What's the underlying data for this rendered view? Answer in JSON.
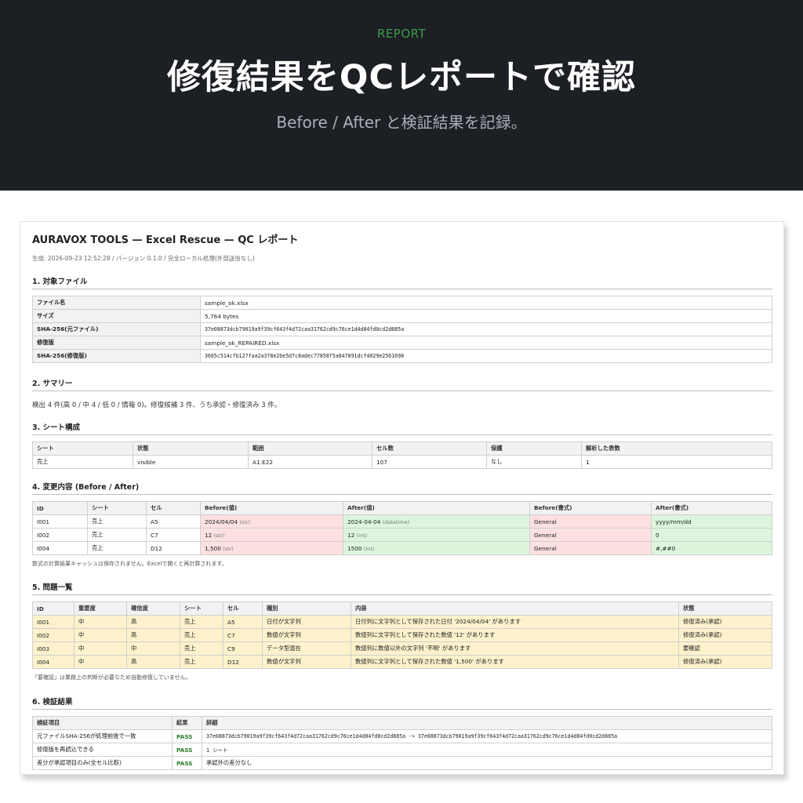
{
  "hero": {
    "tag": "REPORT",
    "title": "修復結果をQCレポートで確認",
    "subtitle": "Before / After と検証結果を記録。"
  },
  "report": {
    "title": "AURAVOX TOOLS — Excel Rescue — QC レポート",
    "meta": "生成: 2026-09-23 12:52:28 / バージョン 0.1.0 / 完全ローカル処理(外部送信なし)",
    "s1": {
      "heading": "1. 対象ファイル",
      "rows": [
        {
          "k": "ファイル名",
          "v": "sample_ok.xlsx"
        },
        {
          "k": "サイズ",
          "v": "5,764 bytes"
        },
        {
          "k": "SHA-256(元ファイル)",
          "v": "37e08873dcb79019a9f39cf643f4d72caa31762cd9c76ce1d4d84fd0cd2d885a"
        },
        {
          "k": "修復版",
          "v": "sample_ok_REPAIRED.xlsx"
        },
        {
          "k": "SHA-256(修復版)",
          "v": "3665c514cfb127faa2a378e2be5d7c8adec77858f5a847891dcf4029e2561698"
        }
      ]
    },
    "s2": {
      "heading": "2. サマリー",
      "text": "検出 4 件(高 0 / 中 4 / 低 0 / 情報 0)。修復候補 3 件、うち承認・修復済み 3 件。"
    },
    "s3": {
      "heading": "3. シート構成",
      "headers": [
        "シート",
        "状態",
        "範囲",
        "セル数",
        "保護",
        "解析した表数"
      ],
      "rows": [
        [
          "売上",
          "visible",
          "A1:E22",
          "107",
          "なし",
          "1"
        ]
      ]
    },
    "s4": {
      "heading": "4. 変更内容 (Before / After)",
      "headers": [
        "ID",
        "シート",
        "セル",
        "Before(値)",
        "After(値)",
        "Before(書式)",
        "After(書式)"
      ],
      "rows": [
        {
          "id": "I001",
          "sheet": "売上",
          "cell": "A5",
          "before": "2024/04/04",
          "before_t": "(str)",
          "after": "2024-04-04",
          "after_t": "(datetime)",
          "bfmt": "General",
          "afmt": "yyyy/mm/dd"
        },
        {
          "id": "I002",
          "sheet": "売上",
          "cell": "C7",
          "before": "12",
          "before_t": "(str)",
          "after": "12",
          "after_t": "(int)",
          "bfmt": "General",
          "afmt": "0"
        },
        {
          "id": "I004",
          "sheet": "売上",
          "cell": "D12",
          "before": "1,500",
          "before_t": "(str)",
          "after": "1500",
          "after_t": "(int)",
          "bfmt": "General",
          "afmt": "#,##0"
        }
      ],
      "note": "数式の計算結果キャッシュは保存されません。Excelで開くと再計算されます。"
    },
    "s5": {
      "heading": "5. 問題一覧",
      "headers": [
        "ID",
        "重要度",
        "確信度",
        "シート",
        "セル",
        "種別",
        "内容",
        "状態"
      ],
      "rows": [
        [
          "I001",
          "中",
          "高",
          "売上",
          "A5",
          "日付が文字列",
          "日付列に文字列として保存された日付 '2024/04/04' があります",
          "修復済み(承認)"
        ],
        [
          "I002",
          "中",
          "高",
          "売上",
          "C7",
          "数値が文字列",
          "数値列に文字列として保存された数値 '12' があります",
          "修復済み(承認)"
        ],
        [
          "I003",
          "中",
          "中",
          "売上",
          "C9",
          "データ型混在",
          "数値列に数値以外の文字列 '不明' があります",
          "要確認"
        ],
        [
          "I004",
          "中",
          "高",
          "売上",
          "D12",
          "数値が文字列",
          "数値列に文字列として保存された数値 '1,500' があります",
          "修復済み(承認)"
        ]
      ],
      "note": "「要確認」は業務上の判断が必要なため自動修復していません。"
    },
    "s6": {
      "heading": "6. 検証結果",
      "headers": [
        "検証項目",
        "結果",
        "詳細"
      ],
      "rows": [
        [
          "元ファイルSHA-256が処理前後で一致",
          "PASS",
          "37e08873dcb79019a9f39cf643f4d72caa31762cd9c76ce1d4d84fd0cd2d885a -> 37e08873dcb79019a9f39cf643f4d72caa31762cd9c76ce1d4d84fd0cd2d885a"
        ],
        [
          "修復版を再読込できる",
          "PASS",
          "1 シート"
        ],
        [
          "差分が承認項目のみ(全セル比較)",
          "PASS",
          "承認外の差分なし"
        ]
      ]
    }
  },
  "colors": {
    "hero_bg": "#1c1f24",
    "accent_green": "#3e9a4c",
    "before_red": "#fde0e0",
    "after_green": "#ddf5dd",
    "warn_yellow": "#fdf2cc",
    "pass_green": "#2a7a2a"
  }
}
